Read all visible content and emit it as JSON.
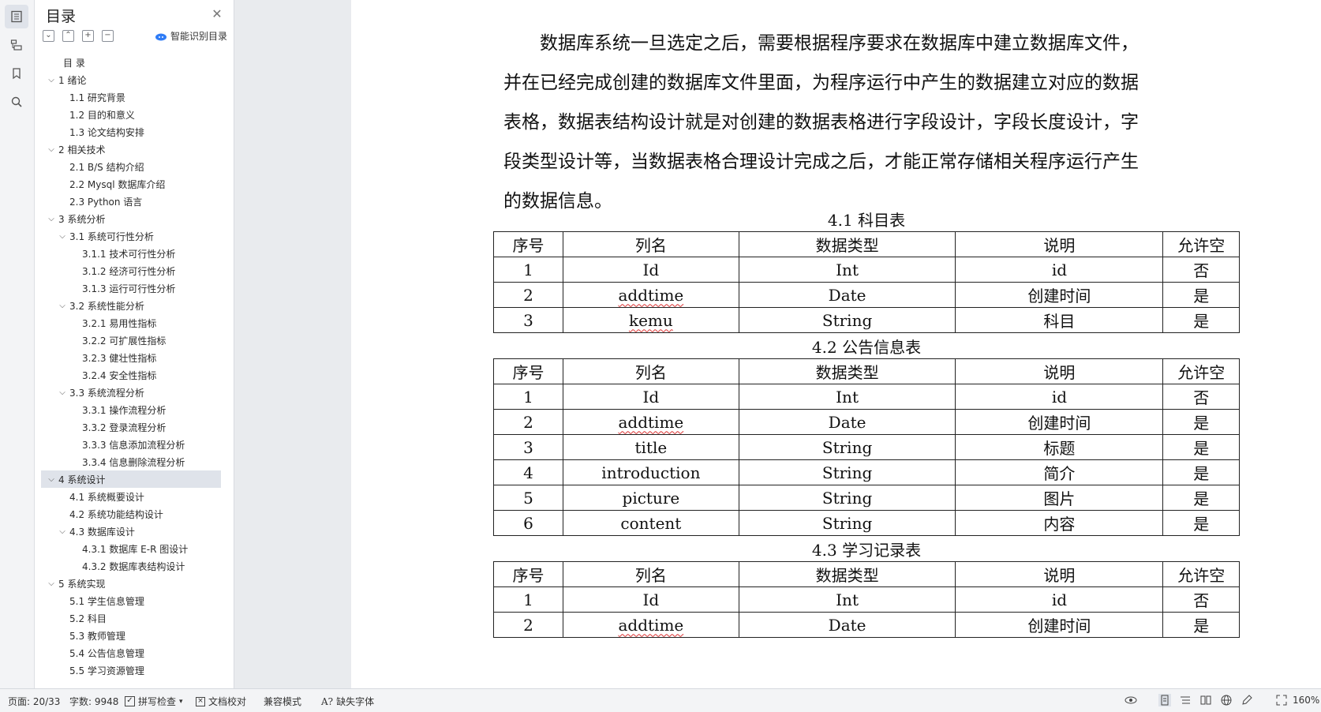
{
  "toc": {
    "title": "目录",
    "smart_label": "智能识别目录",
    "items": [
      {
        "text": "目 录",
        "level": 0,
        "chev": ""
      },
      {
        "text": "1  绪论",
        "level": 0,
        "chev": "v"
      },
      {
        "text": "1.1  研究背景",
        "level": 1,
        "chev": ""
      },
      {
        "text": "1.2  目的和意义",
        "level": 1,
        "chev": ""
      },
      {
        "text": "1.3  论文结构安排",
        "level": 1,
        "chev": ""
      },
      {
        "text": "2  相关技术",
        "level": 0,
        "chev": "v"
      },
      {
        "text": "2.1 B/S 结构介绍",
        "level": 1,
        "chev": ""
      },
      {
        "text": "2.2 Mysql 数据库介绍",
        "level": 1,
        "chev": ""
      },
      {
        "text": "2.3 Python 语言",
        "level": 1,
        "chev": ""
      },
      {
        "text": "3  系统分析",
        "level": 0,
        "chev": "v"
      },
      {
        "text": "3.1  系统可行性分析",
        "level": 1,
        "chev": "v"
      },
      {
        "text": "3.1.1  技术可行性分析",
        "level": 2,
        "chev": ""
      },
      {
        "text": "3.1.2  经济可行性分析",
        "level": 2,
        "chev": ""
      },
      {
        "text": "3.1.3  运行可行性分析",
        "level": 2,
        "chev": ""
      },
      {
        "text": "3.2  系统性能分析",
        "level": 1,
        "chev": "v"
      },
      {
        "text": "3.2.1  易用性指标",
        "level": 2,
        "chev": ""
      },
      {
        "text": "3.2.2  可扩展性指标",
        "level": 2,
        "chev": ""
      },
      {
        "text": "3.2.3  健壮性指标",
        "level": 2,
        "chev": ""
      },
      {
        "text": "3.2.4  安全性指标",
        "level": 2,
        "chev": ""
      },
      {
        "text": "3.3  系统流程分析",
        "level": 1,
        "chev": "v"
      },
      {
        "text": "3.3.1  操作流程分析",
        "level": 2,
        "chev": ""
      },
      {
        "text": "3.3.2  登录流程分析",
        "level": 2,
        "chev": ""
      },
      {
        "text": "3.3.3  信息添加流程分析",
        "level": 2,
        "chev": ""
      },
      {
        "text": "3.3.4  信息删除流程分析",
        "level": 2,
        "chev": ""
      },
      {
        "text": "4  系统设计",
        "level": 0,
        "chev": "v",
        "selected": true
      },
      {
        "text": "4.1  系统概要设计",
        "level": 1,
        "chev": ""
      },
      {
        "text": "4.2  系统功能结构设计",
        "level": 1,
        "chev": ""
      },
      {
        "text": "4.3  数据库设计",
        "level": 1,
        "chev": "v"
      },
      {
        "text": "4.3.1  数据库 E-R 图设计",
        "level": 2,
        "chev": ""
      },
      {
        "text": "4.3.2  数据库表结构设计",
        "level": 2,
        "chev": ""
      },
      {
        "text": "5  系统实现",
        "level": 0,
        "chev": "v"
      },
      {
        "text": "5.1  学生信息管理",
        "level": 1,
        "chev": ""
      },
      {
        "text": "5.2  科目",
        "level": 1,
        "chev": ""
      },
      {
        "text": "5.3  教师管理",
        "level": 1,
        "chev": ""
      },
      {
        "text": "5.4  公告信息管理",
        "level": 1,
        "chev": ""
      },
      {
        "text": "5.5  学习资源管理",
        "level": 1,
        "chev": ""
      }
    ]
  },
  "doc": {
    "paragraph_lines": [
      "数据库系统一旦选定之后，需要根据程序要求在数据库中建立数据库文件，",
      "并在已经完成创建的数据库文件里面，为程序运行中产生的数据建立对应的数据",
      "表格，数据表结构设计就是对创建的数据表格进行字段设计，字段长度设计，字",
      "段类型设计等，当数据表格合理设计完成之后，才能正常存储相关程序运行产生",
      "的数据信息。"
    ],
    "header": [
      "序号",
      "列名",
      "数据类型",
      "说明",
      "允许空"
    ],
    "tables": [
      {
        "caption": "4.1 科目表",
        "rows": [
          [
            "1",
            "Id",
            "Int",
            "id",
            "否"
          ],
          [
            "2",
            "addtime",
            "Date",
            "创建时间",
            "是"
          ],
          [
            "3",
            "kemu",
            "String",
            "科目",
            "是"
          ]
        ]
      },
      {
        "caption": "4.2 公告信息表",
        "rows": [
          [
            "1",
            "Id",
            "Int",
            "id",
            "否"
          ],
          [
            "2",
            "addtime",
            "Date",
            "创建时间",
            "是"
          ],
          [
            "3",
            "title",
            "String",
            "标题",
            "是"
          ],
          [
            "4",
            "introduction",
            "String",
            "简介",
            "是"
          ],
          [
            "5",
            "picture",
            "String",
            "图片",
            "是"
          ],
          [
            "6",
            "content",
            "String",
            "内容",
            "是"
          ]
        ]
      },
      {
        "caption": "4.3 学习记录表",
        "rows": [
          [
            "1",
            "Id",
            "Int",
            "id",
            "否"
          ],
          [
            "2",
            "addtime",
            "Date",
            "创建时间",
            "是"
          ]
        ]
      }
    ]
  },
  "status": {
    "page": "页面: 20/33",
    "words": "字数: 9948",
    "spell": "拼写检查",
    "proof": "文档校对",
    "compat": "兼容模式",
    "missing_font": "缺失字体",
    "zoom": "160%"
  }
}
